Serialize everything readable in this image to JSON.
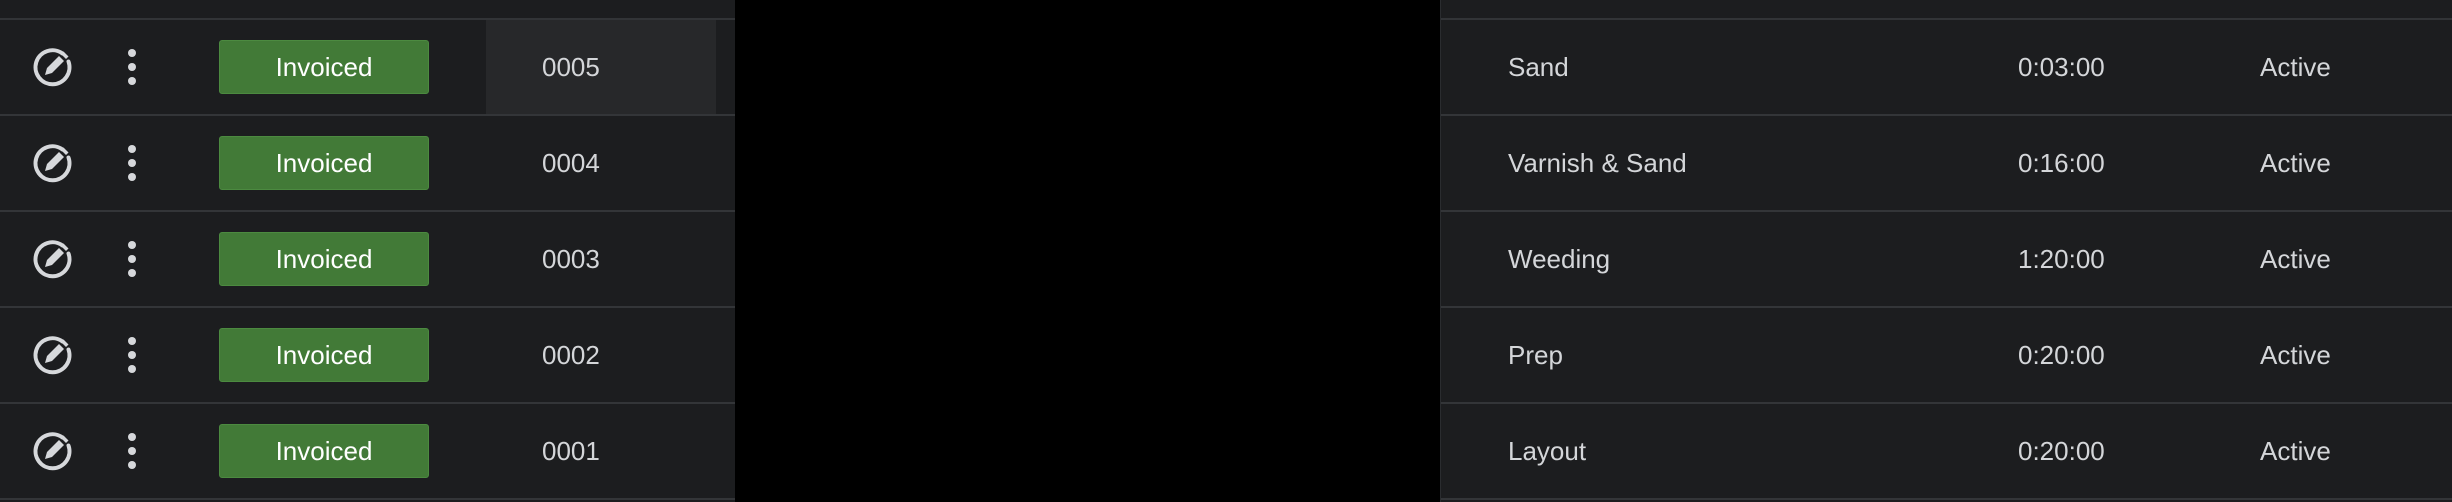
{
  "table": {
    "rows": [
      {
        "status": "Invoiced",
        "id": "0005",
        "task": "Sand",
        "duration": "0:03:00",
        "state": "Active"
      },
      {
        "status": "Invoiced",
        "id": "0004",
        "task": "Varnish & Sand",
        "duration": "0:16:00",
        "state": "Active"
      },
      {
        "status": "Invoiced",
        "id": "0003",
        "task": "Weeding",
        "duration": "1:20:00",
        "state": "Active"
      },
      {
        "status": "Invoiced",
        "id": "0002",
        "task": "Prep",
        "duration": "0:20:00",
        "state": "Active"
      },
      {
        "status": "Invoiced",
        "id": "0001",
        "task": "Layout",
        "duration": "0:20:00",
        "state": "Active"
      }
    ]
  },
  "icons": {
    "edit": "edit-icon",
    "more": "more-vertical-icon"
  },
  "colors": {
    "background": "#1c1d1f",
    "badge": "#427a37",
    "text": "#d4d6d9"
  }
}
